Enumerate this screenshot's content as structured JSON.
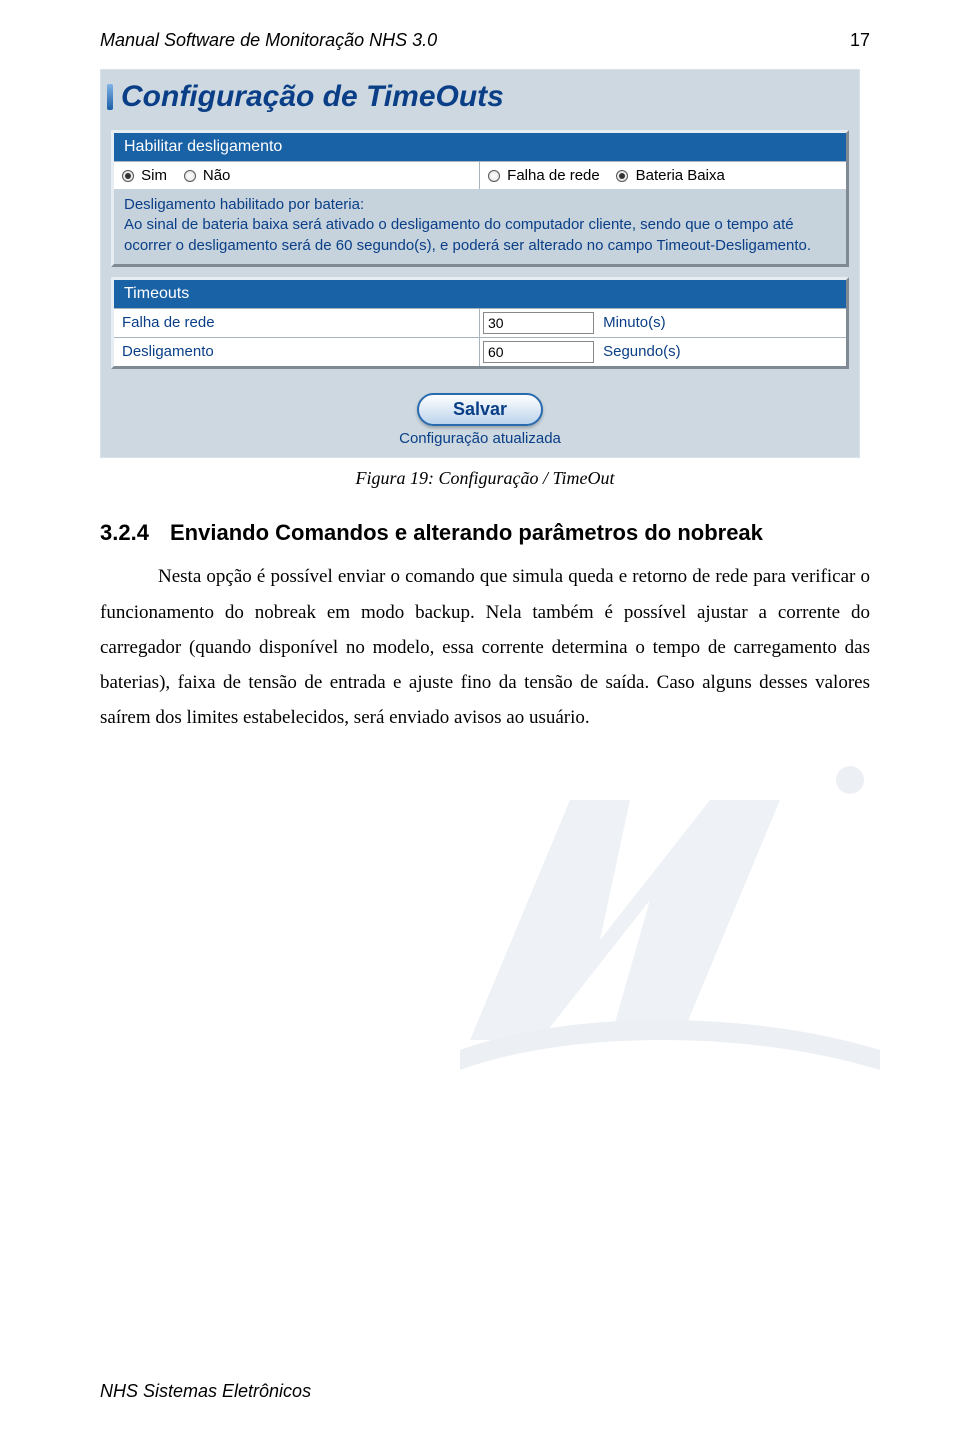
{
  "header": {
    "title": "Manual Software de Monitoração NHS 3.0",
    "page_number": "17"
  },
  "screenshot": {
    "main_title": "Configuração de TimeOuts",
    "panel1": {
      "header": "Habilitar desligamento",
      "opt_sim": "Sim",
      "opt_nao": "Não",
      "opt_falha": "Falha de rede",
      "opt_bateria": "Bateria Baixa"
    },
    "desc": {
      "title": "Desligamento habilitado por bateria:",
      "text": "Ao sinal de bateria baixa será ativado o desligamento do computador cliente, sendo que o tempo até ocorrer o desligamento será de 60 segundo(s), e poderá ser alterado no campo Timeout-Desligamento."
    },
    "panel2": {
      "header": "Timeouts",
      "row1_label": "Falha de rede",
      "row1_value": "30",
      "row1_unit": "Minuto(s)",
      "row2_label": "Desligamento",
      "row2_value": "60",
      "row2_unit": "Segundo(s)"
    },
    "save_button": "Salvar",
    "save_status": "Configuração atualizada"
  },
  "figure_caption": "Figura 19: Configuração / TimeOut",
  "section": {
    "number": "3.2.4",
    "title": "Enviando Comandos e alterando parâmetros do nobreak",
    "paragraph": "Nesta opção é possível enviar o comando que simula queda e retorno de rede para verificar o funcionamento do nobreak em modo backup. Nela também é possível ajustar a corrente do carregador (quando disponível no modelo, essa corrente determina  o tempo de carregamento das baterias), faixa de tensão de entrada e ajuste fino da tensão de saída. Caso alguns desses valores saírem dos limites estabelecidos, será enviado avisos ao usuário."
  },
  "footer": "NHS Sistemas Eletrônicos"
}
